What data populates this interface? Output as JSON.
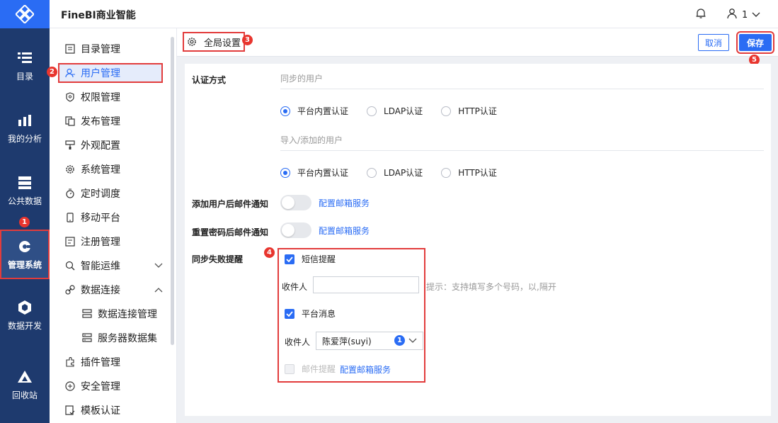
{
  "app": {
    "title": "FineBI商业智能",
    "user_name": "1"
  },
  "rail": [
    {
      "label": "目录",
      "icon": "catalog-icon"
    },
    {
      "label": "我的分析",
      "icon": "analysis-icon"
    },
    {
      "label": "公共数据",
      "icon": "public-data-icon"
    },
    {
      "label": "管理系统",
      "icon": "admin-system-icon"
    },
    {
      "label": "数据开发",
      "icon": "data-dev-icon"
    },
    {
      "label": "回收站",
      "icon": "recycle-bin-icon"
    }
  ],
  "menu": [
    {
      "label": "目录管理",
      "icon": "list-icon"
    },
    {
      "label": "用户管理",
      "icon": "user-icon"
    },
    {
      "label": "权限管理",
      "icon": "permission-icon"
    },
    {
      "label": "发布管理",
      "icon": "publish-icon"
    },
    {
      "label": "外观配置",
      "icon": "paint-icon"
    },
    {
      "label": "系统管理",
      "icon": "gear-icon"
    },
    {
      "label": "定时调度",
      "icon": "timer-icon"
    },
    {
      "label": "移动平台",
      "icon": "mobile-icon"
    },
    {
      "label": "注册管理",
      "icon": "register-icon"
    },
    {
      "label": "智能运维",
      "icon": "ops-icon"
    },
    {
      "label": "数据连接",
      "icon": "link-icon"
    },
    {
      "label": "数据连接管理",
      "icon": "db-icon"
    },
    {
      "label": "服务器数据集",
      "icon": "server-dataset-icon"
    },
    {
      "label": "插件管理",
      "icon": "plugin-icon"
    },
    {
      "label": "安全管理",
      "icon": "shield-icon"
    },
    {
      "label": "模板认证",
      "icon": "template-icon"
    }
  ],
  "tabbar": {
    "tab_label": "全局设置",
    "cancel_label": "取消",
    "save_label": "保存"
  },
  "badges": {
    "b1": "1",
    "b2": "2",
    "b3": "3",
    "b4": "4",
    "b5": "5"
  },
  "settings": {
    "auth_label": "认证方式",
    "sync_users_title": "同步的用户",
    "import_users_title": "导入/添加的用户",
    "radio_options": [
      "平台内置认证",
      "LDAP认证",
      "HTTP认证"
    ],
    "mail_after_add_label": "添加用户后邮件通知",
    "mail_after_reset_label": "重置密码后邮件通知",
    "config_mail_link": "配置邮箱服务",
    "sync_fail_label": "同步失败提醒",
    "sms_label": "短信提醒",
    "recipient_label": "收件人",
    "sms_hint": "提示：支持填写多个号码，以,隔开",
    "platform_msg_label": "平台消息",
    "recipient_selected": "陈爱萍(suyi)",
    "recipient_count": "1",
    "email_reminder_label": "邮件提醒"
  }
}
